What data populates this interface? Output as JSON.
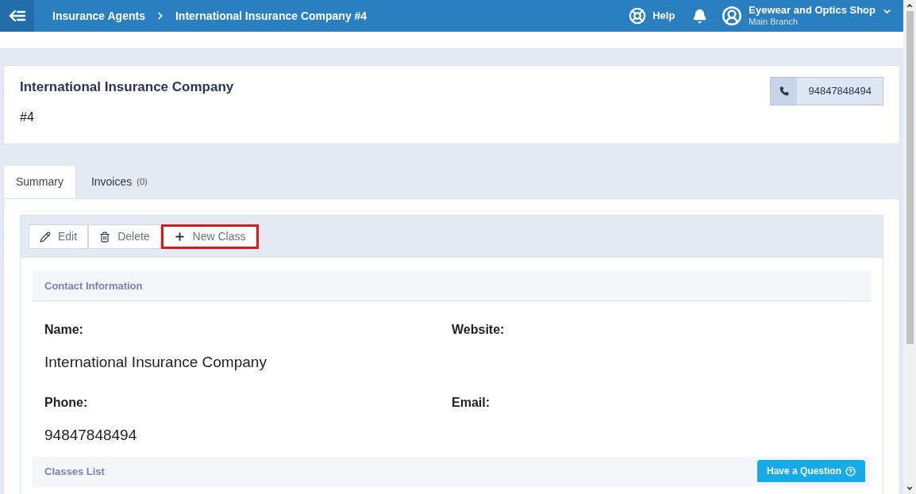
{
  "topbar": {
    "breadcrumbs": [
      {
        "label": "Insurance Agents"
      },
      {
        "label": "International Insurance Company #4"
      }
    ],
    "help": "Help",
    "account": {
      "name": "Eyewear and Optics Shop",
      "branch": "Main Branch"
    }
  },
  "header": {
    "title": "International Insurance Company",
    "number": "#4",
    "phone": "94847848494"
  },
  "tabs": [
    {
      "label": "Summary",
      "selected": true
    },
    {
      "label": "Invoices",
      "count": "(0)",
      "selected": false
    }
  ],
  "toolbar": [
    {
      "kind": "edit",
      "label": "Edit",
      "highlighted": false
    },
    {
      "kind": "delete",
      "label": "Delete",
      "highlighted": false
    },
    {
      "kind": "add",
      "label": "New Class",
      "highlighted": true
    }
  ],
  "contact": {
    "title": "Contact Information",
    "fields": [
      {
        "label": "Name:",
        "value": "International Insurance Company"
      },
      {
        "label": "Website:"
      },
      {
        "label": "Phone:",
        "value": "94847848494"
      },
      {
        "label": "Email:"
      }
    ]
  },
  "classes_list": {
    "title": "Classes List"
  },
  "help_button": "Have a Question"
}
